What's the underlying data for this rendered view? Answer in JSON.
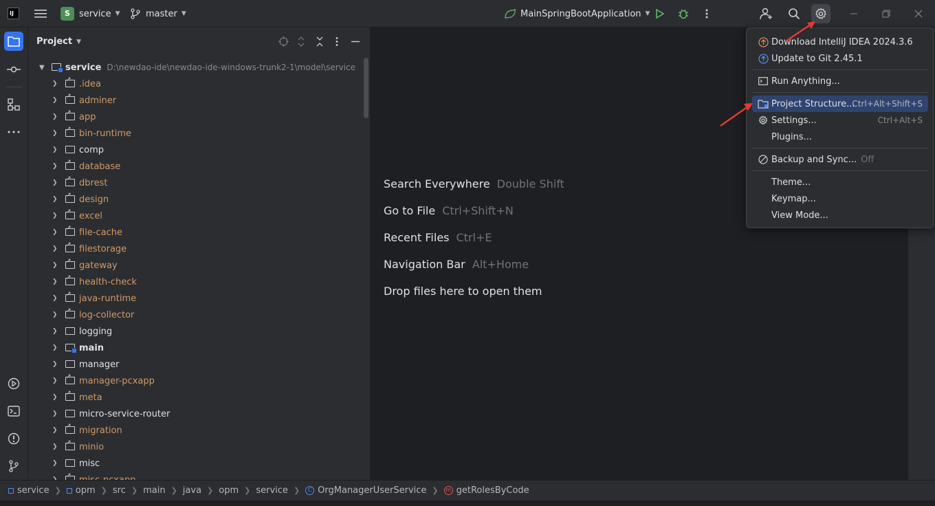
{
  "titlebar": {
    "project_initial": "S",
    "project_name": "service",
    "branch": "master",
    "run_config": "MainSpringBootApplication"
  },
  "project_panel": {
    "title": "Project",
    "root": {
      "name": "service",
      "path": "D:\\newdao-ide\\newdao-ide-windows-trunk2-1\\model\\service"
    },
    "items": [
      {
        "name": ".idea",
        "style": "orange"
      },
      {
        "name": "adminer",
        "style": "orange"
      },
      {
        "name": "app",
        "style": "orange"
      },
      {
        "name": "bin-runtime",
        "style": "orange"
      },
      {
        "name": "comp",
        "style": "plain"
      },
      {
        "name": "database",
        "style": "orange"
      },
      {
        "name": "dbrest",
        "style": "orange"
      },
      {
        "name": "design",
        "style": "orange"
      },
      {
        "name": "excel",
        "style": "orange"
      },
      {
        "name": "file-cache",
        "style": "orange"
      },
      {
        "name": "filestorage",
        "style": "orange"
      },
      {
        "name": "gateway",
        "style": "orange"
      },
      {
        "name": "health-check",
        "style": "orange"
      },
      {
        "name": "java-runtime",
        "style": "orange"
      },
      {
        "name": "log-collector",
        "style": "orange"
      },
      {
        "name": "logging",
        "style": "plain"
      },
      {
        "name": "main",
        "style": "bold"
      },
      {
        "name": "manager",
        "style": "plain"
      },
      {
        "name": "manager-pcxapp",
        "style": "orange"
      },
      {
        "name": "meta",
        "style": "orange"
      },
      {
        "name": "micro-service-router",
        "style": "plain"
      },
      {
        "name": "migration",
        "style": "orange"
      },
      {
        "name": "minio",
        "style": "orange"
      },
      {
        "name": "misc",
        "style": "plain"
      },
      {
        "name": "misc-pcxapp",
        "style": "orange"
      }
    ]
  },
  "editor_hints": [
    {
      "action": "Search Everywhere",
      "shortcut": "Double Shift"
    },
    {
      "action": "Go to File",
      "shortcut": "Ctrl+Shift+N"
    },
    {
      "action": "Recent Files",
      "shortcut": "Ctrl+E"
    },
    {
      "action": "Navigation Bar",
      "shortcut": "Alt+Home"
    },
    {
      "action": "Drop files here to open them",
      "shortcut": ""
    }
  ],
  "menu": {
    "download": "Download IntelliJ IDEA 2024.3.6",
    "update_git": "Update to Git 2.45.1",
    "run_anything": "Run Anything...",
    "project_structure": "Project Structure...",
    "project_structure_key": "Ctrl+Alt+Shift+S",
    "settings": "Settings...",
    "settings_key": "Ctrl+Alt+S",
    "plugins": "Plugins...",
    "backup": "Backup and Sync...",
    "backup_state": "Off",
    "theme": "Theme...",
    "keymap": "Keymap...",
    "view_mode": "View Mode..."
  },
  "breadcrumb": [
    "service",
    "opm",
    "src",
    "main",
    "java",
    "opm",
    "service",
    "OrgManagerUserService",
    "getRolesByCode"
  ],
  "colors": {
    "accent": "#3574f0",
    "selection": "#2e436e",
    "annotation_arrow": "#e53935",
    "folder_orange": "#d19a66"
  }
}
